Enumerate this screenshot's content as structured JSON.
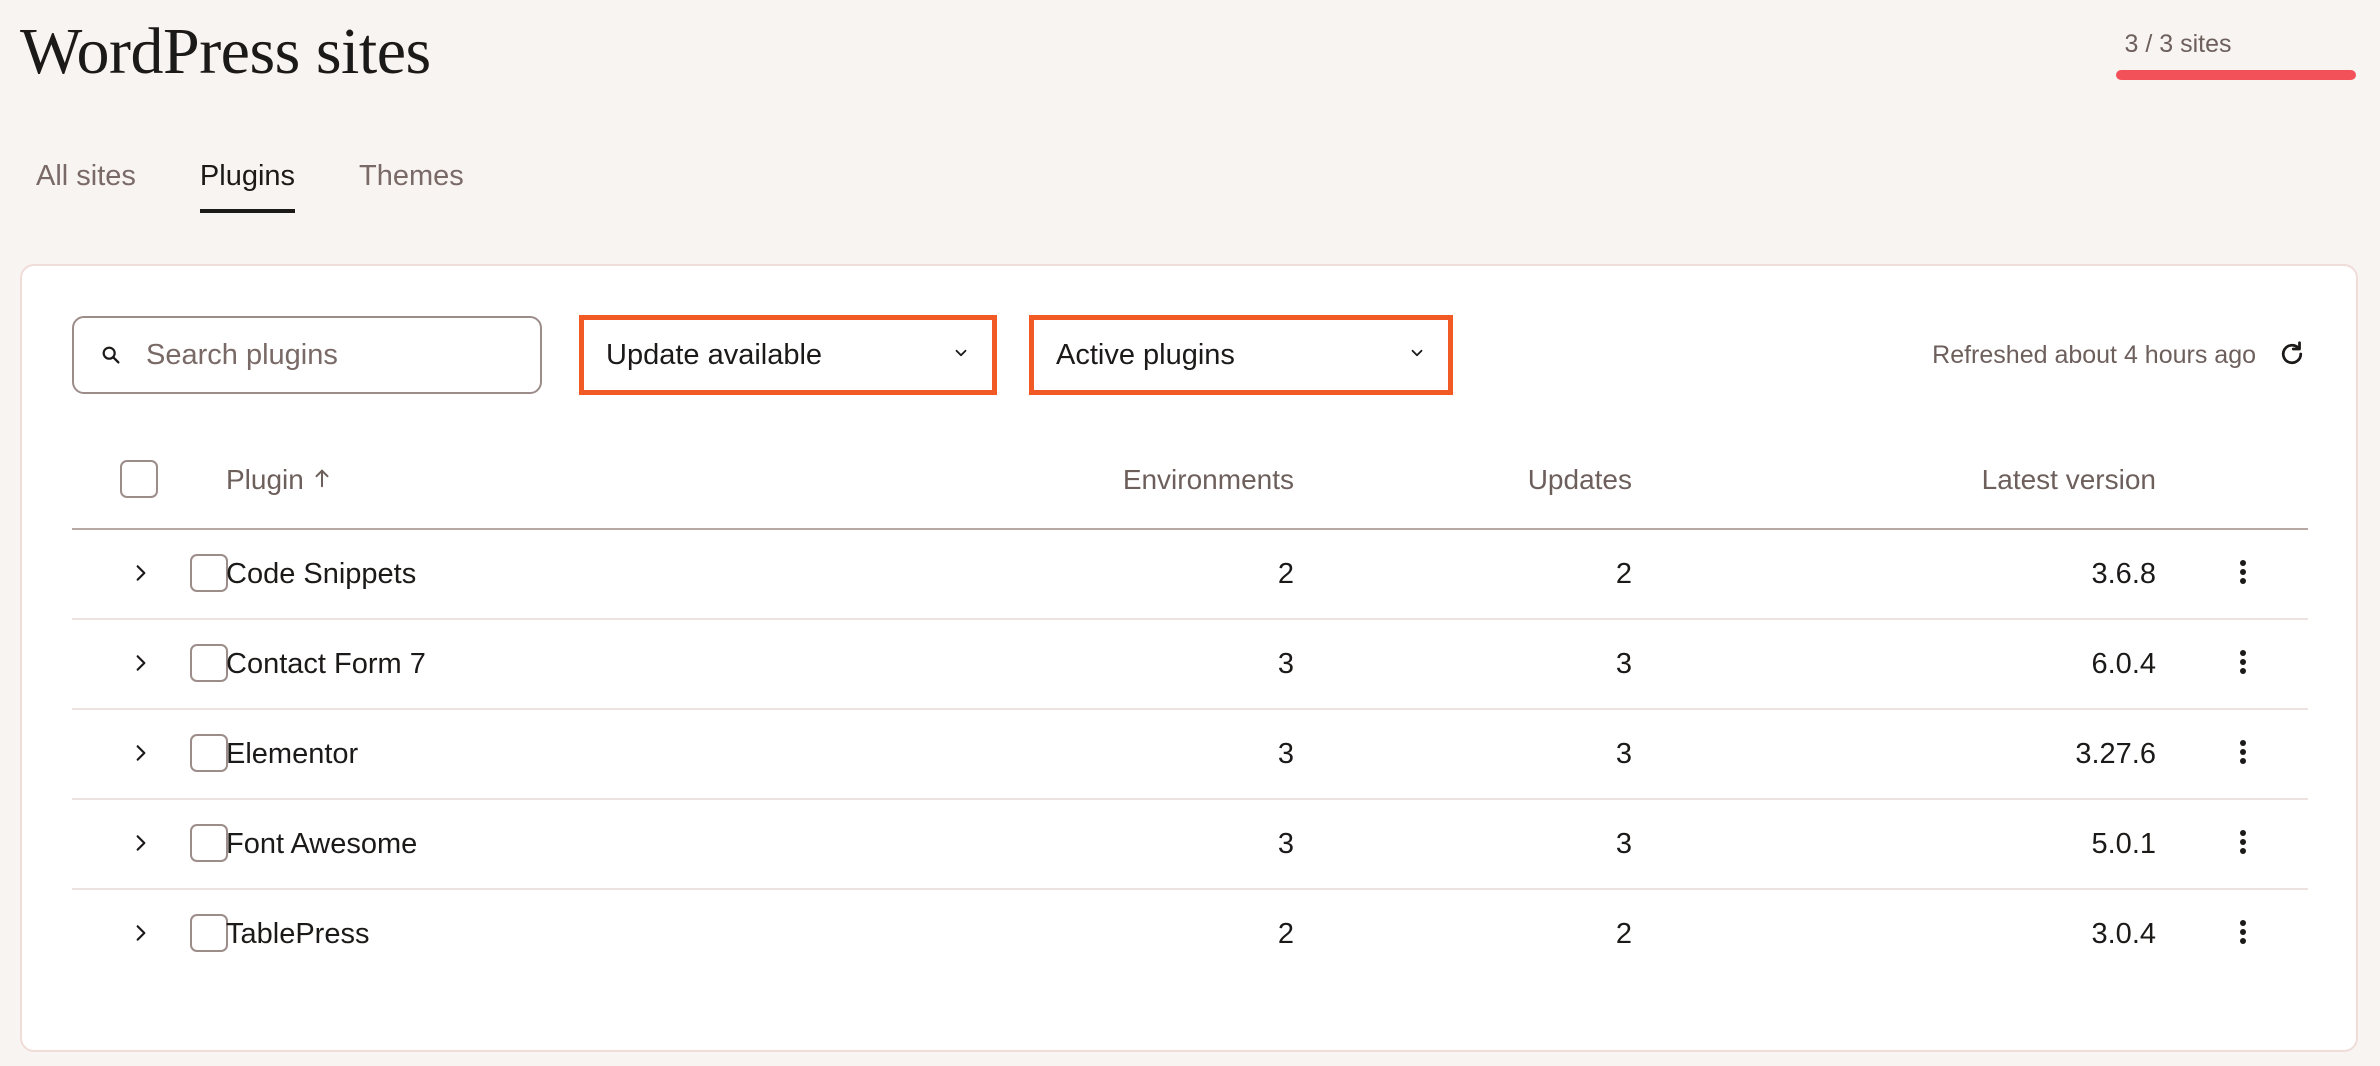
{
  "header": {
    "title": "WordPress sites",
    "site_count": "3 / 3 sites",
    "accent_color": "#f2515a"
  },
  "tabs": [
    {
      "label": "All sites",
      "active": false
    },
    {
      "label": "Plugins",
      "active": true
    },
    {
      "label": "Themes",
      "active": false
    }
  ],
  "toolbar": {
    "search_placeholder": "Search plugins",
    "filter_status": "Update available",
    "filter_activity": "Active plugins",
    "refreshed_text": "Refreshed about 4 hours ago",
    "highlight_color": "#f15a24"
  },
  "table": {
    "columns": {
      "plugin": "Plugin",
      "environments": "Environments",
      "updates": "Updates",
      "latest_version": "Latest version"
    },
    "sort": {
      "column": "plugin",
      "direction": "ascending"
    },
    "rows": [
      {
        "name": "Code Snippets",
        "environments": "2",
        "updates": "2",
        "latest_version": "3.6.8"
      },
      {
        "name": "Contact Form 7",
        "environments": "3",
        "updates": "3",
        "latest_version": "6.0.4"
      },
      {
        "name": "Elementor",
        "environments": "3",
        "updates": "3",
        "latest_version": "3.27.6"
      },
      {
        "name": "Font Awesome",
        "environments": "3",
        "updates": "3",
        "latest_version": "5.0.1"
      },
      {
        "name": "TablePress",
        "environments": "2",
        "updates": "2",
        "latest_version": "3.0.4"
      }
    ]
  }
}
